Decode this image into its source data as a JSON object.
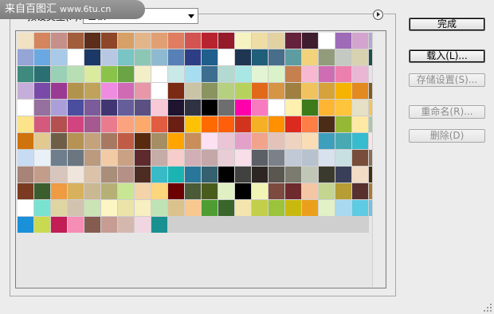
{
  "watermark": {
    "text": "来自百图汇",
    "url": "www.6tu.cn"
  },
  "preset": {
    "label": "预设类型(P):",
    "value": "色板"
  },
  "buttons": {
    "done": "完成",
    "load": "载入(L)...",
    "save": "存储设置(S)...",
    "rename": "重命名(R)...",
    "delete": "删除(D)"
  },
  "swatches": [
    "#f1e2c4",
    "#d4855d",
    "#c6908a",
    "#a25e3b",
    "#5b2d1a",
    "#8d4628",
    "#d7a067",
    "#e3b58a",
    "#e0a074",
    "#e07d60",
    "#d35350",
    "#b7242f",
    "#951b2b",
    "#f6f3c2",
    "#eedda4",
    "#e2d2a1",
    "#65233b",
    "#3e1e2e",
    "#ffffff",
    "#9d6bb8",
    "#d3a4cd",
    "#b6a6d4",
    "#94a5d6",
    "#6aa8e2",
    "#a8c9e8",
    "#ffffff",
    "#1c3866",
    "#b8c8e3",
    "#79c4c4",
    "#8cc7b6",
    "#8dbad0",
    "#5680b6",
    "#2e3e86",
    "#1f5e8d",
    "#ffffff",
    "#1e3651",
    "#1f5f7a",
    "#486e8c",
    "#5d9da2",
    "#f2d27a",
    "#929c7d",
    "#c4c9c2",
    "#d9d2b0",
    "#1c4f4a",
    "#3e8a7f",
    "#2b6f73",
    "#9ad0b5",
    "#b8dfb4",
    "#daeb9e",
    "#8bc34a",
    "#6aa444",
    "#f2eec8",
    "#ffffff",
    "#c9e9e9",
    "#a7ddf0",
    "#3b6e8f",
    "#b2dad1",
    "#a9e7e5",
    "#e3f4d4",
    "#d9f2c8",
    "#c67f4f",
    "#f7b9d1",
    "#ce6db3",
    "#ec7fad",
    "#e9b6d3",
    "#ecdeef",
    "#c6aeda",
    "#7a4aa8",
    "#9a3a93",
    "#b2934d",
    "#c0a25b",
    "#ef8ce0",
    "#cf6bb5",
    "#e797a8",
    "#ffffff",
    "#7b2a14",
    "#cbc3a5",
    "#8a9460",
    "#b5d07f",
    "#b6d25d",
    "#e0691c",
    "#d69544",
    "#9f8040",
    "#f1c35f",
    "#d6a23a",
    "#f6b300",
    "#e38a1e",
    "#7f5c1e",
    "#ffffff",
    "#96709e",
    "#ab9fd9",
    "#4b4d9e",
    "#7c5b9b",
    "#413673",
    "#665e9b",
    "#5c5083",
    "#f8c8d6",
    "#1e1430",
    "#2f3241",
    "#000000",
    "#6e6e6e",
    "#ff00aa",
    "#f97bbf",
    "#ffffff",
    "#fff0b0",
    "#3c7a1a",
    "#fdb533",
    "#fec43b",
    "#e6e0c6",
    "#f1c45f",
    "#fbe48a",
    "#d45a7d",
    "#b45050",
    "#d1447f",
    "#a6598e",
    "#ea7b8e",
    "#fba27e",
    "#fda96c",
    "#e15c41",
    "#6a1f12",
    "#ffc105",
    "#ff6a00",
    "#ff5f0a",
    "#d1341d",
    "#f5b026",
    "#ff9000",
    "#dc2a1e",
    "#ff7e45",
    "#4b2d17",
    "#96b837",
    "#fde9a4",
    "#adc6a4",
    "#cf730f",
    "#e2c990",
    "#6e5e48",
    "#b69255",
    "#c4a27b",
    "#a77963",
    "#c05b46",
    "#5a2a0f",
    "#a58e64",
    "#ffa400",
    "#c98e59",
    "#fbe1f1",
    "#ebc4d6",
    "#e3a1c9",
    "#f2a38b",
    "#e3c3b9",
    "#eed3c1",
    "#f8ddb7",
    "#3e9fbc",
    "#49a9b2",
    "#36bbcf",
    "#fae2e8",
    "#c7dbf3",
    "#e9f0f7",
    "#6e7e8c",
    "#6c7680",
    "#bb9a7e",
    "#f2cba5",
    "#caa183",
    "#5e2a2d",
    "#c5aca6",
    "#f6cdcb",
    "#d2aeb6",
    "#c4a7a8",
    "#e8ccd6",
    "#f7dee9",
    "#5b5f66",
    "#7c8189",
    "#c0c9d5",
    "#b8c2cf",
    "#d7e2ee",
    "#c9e0e3",
    "#784e3a",
    "#8c6d53",
    "#a88377",
    "#c49c8a",
    "#d8c5bb",
    "#f0e5dd",
    "#dcc2a8",
    "#a98e7a",
    "#b49087",
    "#4d2d22",
    "#38bac7",
    "#1ab4b2",
    "#28779a",
    "#34606f",
    "#010101",
    "#414140",
    "#2e2622",
    "#59574f",
    "#7b7b6f",
    "#c0c7b7",
    "#3a3a2e",
    "#3a3f59",
    "#f2dcc6",
    "#412d10",
    "#7a3b20",
    "#3b5e2e",
    "#ee9b42",
    "#d7b15c",
    "#c9b891",
    "#b7b076",
    "#c8e694",
    "#f3d3a7",
    "#fcd67c",
    "#6b0100",
    "#4b5a37",
    "#4a5c1d",
    "#e1f0c2",
    "#000000",
    "#f2f4b5",
    "#7c4a3e",
    "#6e2a2d",
    "#f4c6a4",
    "#c3d58f",
    "#b69d34",
    "#58302e",
    "#a97b33",
    "#ffffff",
    "#78e3d1",
    "#dfd5a3",
    "#d2c3af",
    "#cbe3b5",
    "#fdf5c3",
    "#ebe3a8",
    "#f8efc0",
    "#bfe3b4",
    "#dbc28d",
    "#f9c88f",
    "#4e9d32",
    "#3a662c",
    "#f4e4ad",
    "#c2cf4a",
    "#9bc43a",
    "#c9b90f",
    "#eba01d",
    "#e3f1c6",
    "#a9d9ee",
    "#5dcbe3",
    "#6cc5e2",
    "#1a90d9",
    "#c9d950",
    "#c21d54",
    "#f58db5",
    "#855c4f",
    "#c69c93",
    "#d4b8ae",
    "#f0d6e0",
    "#1a9191"
  ]
}
